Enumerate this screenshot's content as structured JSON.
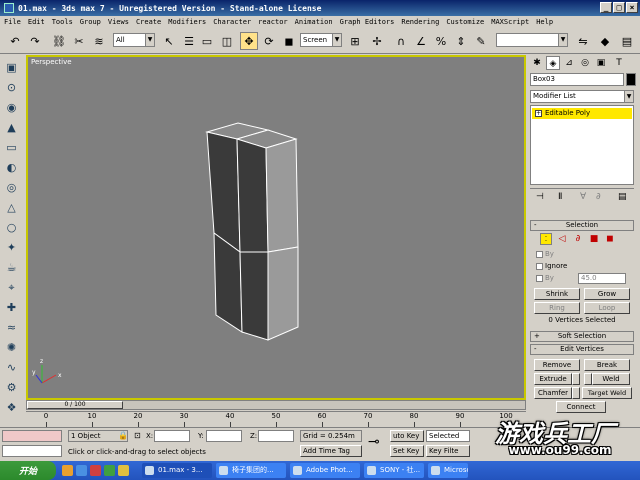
{
  "window": {
    "title": "01.max - 3ds max 7 - Unregistered Version - Stand-alone License",
    "min": "_",
    "max": "□",
    "close": "×"
  },
  "menu": [
    "File",
    "Edit",
    "Tools",
    "Group",
    "Views",
    "Create",
    "Modifiers",
    "Character",
    "reactor",
    "Animation",
    "Graph Editors",
    "Rendering",
    "Customize",
    "MAXScript",
    "Help"
  ],
  "toolbar": {
    "selection_filter": "All",
    "ref_coord": "Screen",
    "named_selection": ""
  },
  "viewport": {
    "label": "Perspective",
    "axis_x": "x",
    "axis_y": "y",
    "axis_z": "z"
  },
  "timeslider": {
    "label": "0 / 100"
  },
  "trackbar": {
    "ticks": [
      "0",
      "10",
      "20",
      "30",
      "40",
      "50",
      "60",
      "70",
      "80",
      "90",
      "100"
    ]
  },
  "command_panel": {
    "object_name": "Box03",
    "object_color": "#000000",
    "modifier_list": "Modifier List",
    "stack_item": "Editable Poly",
    "selection": {
      "title": "Selection",
      "sign": "-",
      "by_vertex": "By",
      "ignore": "Ignore",
      "by_angle": "By",
      "angle_value": "45.0",
      "shrink": "Shrink",
      "grow": "Grow",
      "ring": "Ring",
      "loop": "Loop",
      "status": "0 Vertices Selected"
    },
    "soft_selection": {
      "title": "Soft Selection",
      "sign": "+"
    },
    "edit_vertices": {
      "title": "Edit Vertices",
      "sign": "-",
      "remove": "Remove",
      "break": "Break",
      "extrude": "Extrude",
      "weld": "Weld",
      "chamfer": "Chamfer",
      "target_weld": "Target Weld",
      "connect": "Connect"
    }
  },
  "statusbar": {
    "objects": "1 Object",
    "x_label": "X:",
    "y_label": "Y:",
    "z_label": "Z:",
    "grid": "Grid = 0.254m",
    "prompt": "Click or click-and-drag to select objects",
    "add_time_tag": "Add Time Tag",
    "auto_key": "uto Key",
    "set_key": "Set Key",
    "selected": "Selected",
    "key_filters": "Key Filte"
  },
  "taskbar": {
    "start": "开始",
    "tasks": [
      "01.max - 3...",
      "椅子集团的...",
      "Adobe Phot...",
      "SONY - 社...",
      "Microsoft..."
    ]
  },
  "watermark": {
    "text": "游戏兵工厂",
    "url": "www.ou99.com"
  }
}
